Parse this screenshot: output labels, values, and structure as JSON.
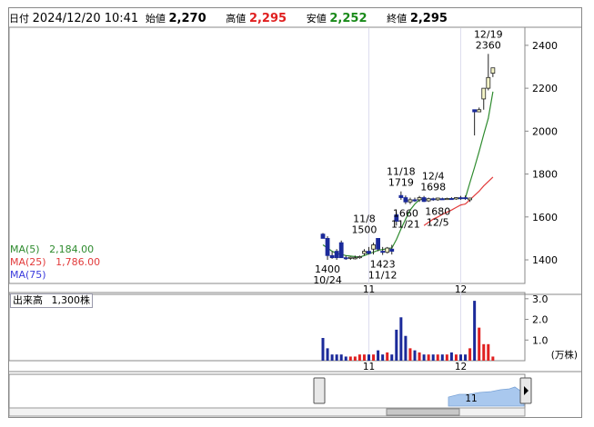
{
  "header": {
    "date_label": "日付",
    "date_value": "2024/12/20 10:41",
    "open_label": "始値",
    "open_value": "2,270",
    "high_label": "高値",
    "high_value": "2,295",
    "low_label": "安値",
    "low_value": "2,252",
    "close_label": "終値",
    "close_value": "2,295"
  },
  "moving_averages": [
    {
      "name": "MA(5)",
      "value": "2,184.00",
      "color": "#2e8b2e"
    },
    {
      "name": "MA(25)",
      "value": "1,786.00",
      "color": "#e23b3b"
    },
    {
      "name": "MA(75)",
      "value": "",
      "color": "#3b3bdd"
    }
  ],
  "volume_legend": {
    "label": "出来高",
    "value": "1,300株"
  },
  "volume_unit": "(万株)",
  "colors": {
    "up": "#f5f5c8",
    "down": "#1b2a9a",
    "vol_up": "#e02020",
    "vol_down": "#1b2a9a",
    "ma5": "#2e8b2e",
    "ma25": "#e23b3b",
    "navigator_fill": "#a9c8ee"
  },
  "chart_data": {
    "type": "candlestick",
    "price_axis": {
      "ticks": [
        1400,
        1600,
        1800,
        2000,
        2200,
        2400
      ],
      "ylim": [
        1290,
        2480
      ]
    },
    "volume_axis": {
      "ticks": [
        "1.0",
        "2.0",
        "3.0"
      ],
      "ylim": [
        0,
        3.3
      ],
      "unit": "(万株)"
    },
    "x_ticks": [
      {
        "label": "11",
        "index": 10
      },
      {
        "label": "12",
        "index": 30
      }
    ],
    "candles": [
      {
        "o": 1520,
        "h": 1525,
        "l": 1500,
        "c": 1500,
        "v": 1.1
      },
      {
        "o": 1500,
        "h": 1510,
        "l": 1400,
        "c": 1420,
        "v": 0.6
      },
      {
        "o": 1420,
        "h": 1440,
        "l": 1405,
        "c": 1410,
        "v": 0.3
      },
      {
        "o": 1440,
        "h": 1450,
        "l": 1400,
        "c": 1410,
        "v": 0.3
      },
      {
        "o": 1480,
        "h": 1490,
        "l": 1420,
        "c": 1410,
        "v": 0.3
      },
      {
        "o": 1410,
        "h": 1420,
        "l": 1400,
        "c": 1405,
        "v": 0.2
      },
      {
        "o": 1410,
        "h": 1415,
        "l": 1400,
        "c": 1412,
        "v": 0.2
      },
      {
        "o": 1405,
        "h": 1420,
        "l": 1402,
        "c": 1410,
        "v": 0.2
      },
      {
        "o": 1410,
        "h": 1420,
        "l": 1405,
        "c": 1415,
        "v": 0.3
      },
      {
        "o": 1430,
        "h": 1450,
        "l": 1420,
        "c": 1440,
        "v": 0.3
      },
      {
        "o": 1440,
        "h": 1460,
        "l": 1425,
        "c": 1430,
        "v": 0.3
      },
      {
        "o": 1450,
        "h": 1480,
        "l": 1425,
        "c": 1470,
        "v": 0.3
      },
      {
        "o": 1500,
        "h": 1500,
        "l": 1440,
        "c": 1450,
        "v": 0.5
      },
      {
        "o": 1440,
        "h": 1460,
        "l": 1423,
        "c": 1435,
        "v": 0.3
      },
      {
        "o": 1435,
        "h": 1460,
        "l": 1430,
        "c": 1455,
        "v": 0.4
      },
      {
        "o": 1450,
        "h": 1470,
        "l": 1425,
        "c": 1440,
        "v": 0.3
      },
      {
        "o": 1610,
        "h": 1620,
        "l": 1560,
        "c": 1580,
        "v": 1.5
      },
      {
        "o": 1700,
        "h": 1719,
        "l": 1680,
        "c": 1690,
        "v": 2.1
      },
      {
        "o": 1690,
        "h": 1700,
        "l": 1660,
        "c": 1670,
        "v": 1.2
      },
      {
        "o": 1670,
        "h": 1690,
        "l": 1660,
        "c": 1680,
        "v": 0.6
      },
      {
        "o": 1680,
        "h": 1690,
        "l": 1670,
        "c": 1675,
        "v": 0.5
      },
      {
        "o": 1680,
        "h": 1698,
        "l": 1670,
        "c": 1690,
        "v": 0.4
      },
      {
        "o": 1690,
        "h": 1698,
        "l": 1670,
        "c": 1672,
        "v": 0.3
      },
      {
        "o": 1675,
        "h": 1690,
        "l": 1670,
        "c": 1685,
        "v": 0.3
      },
      {
        "o": 1685,
        "h": 1690,
        "l": 1675,
        "c": 1680,
        "v": 0.3
      },
      {
        "o": 1680,
        "h": 1690,
        "l": 1675,
        "c": 1688,
        "v": 0.3
      },
      {
        "o": 1685,
        "h": 1690,
        "l": 1680,
        "c": 1682,
        "v": 0.3
      },
      {
        "o": 1682,
        "h": 1690,
        "l": 1680,
        "c": 1686,
        "v": 0.3
      },
      {
        "o": 1686,
        "h": 1692,
        "l": 1680,
        "c": 1684,
        "v": 0.4
      },
      {
        "o": 1684,
        "h": 1692,
        "l": 1680,
        "c": 1690,
        "v": 0.3
      },
      {
        "o": 1690,
        "h": 1698,
        "l": 1680,
        "c": 1685,
        "v": 0.3
      },
      {
        "o": 1690,
        "h": 1700,
        "l": 1680,
        "c": 1685,
        "v": 0.3
      },
      {
        "o": 1680,
        "h": 1690,
        "l": 1670,
        "c": 1688,
        "v": 0.6
      },
      {
        "o": 2100,
        "h": 2100,
        "l": 1980,
        "c": 2090,
        "v": 2.9
      },
      {
        "o": 2090,
        "h": 2110,
        "l": 2090,
        "c": 2100,
        "v": 1.6
      },
      {
        "o": 2150,
        "h": 2200,
        "l": 2100,
        "c": 2200,
        "v": 0.8
      },
      {
        "o": 2200,
        "h": 2360,
        "l": 2190,
        "c": 2250,
        "v": 0.8
      },
      {
        "o": 2270,
        "h": 2295,
        "l": 2252,
        "c": 2295,
        "v": 0.2
      }
    ],
    "ma5_series": [
      1470,
      1455,
      1440,
      1430,
      1425,
      1420,
      1418,
      1415,
      1413,
      1420,
      1428,
      1436,
      1445,
      1448,
      1452,
      1455,
      1495,
      1545,
      1590,
      1632,
      1660,
      1680,
      1683,
      1682,
      1682,
      1683,
      1684,
      1684,
      1685,
      1686,
      1686,
      1687,
      1760,
      1830,
      1905,
      1985,
      2060,
      2184
    ],
    "ma25_series": [
      null,
      null,
      null,
      null,
      null,
      null,
      null,
      null,
      null,
      null,
      null,
      null,
      null,
      null,
      null,
      null,
      null,
      null,
      null,
      null,
      null,
      null,
      1560,
      1575,
      1590,
      1600,
      1612,
      1622,
      1632,
      1644,
      1656,
      1660,
      1680,
      1700,
      1720,
      1745,
      1765,
      1786
    ],
    "annotations": [
      {
        "index": 1,
        "value": 1400,
        "lines": [
          "1400",
          "10/24"
        ],
        "pos": "below"
      },
      {
        "index": 9,
        "value": 1500,
        "lines": [
          "11/8",
          "1500"
        ],
        "pos": "above"
      },
      {
        "index": 13,
        "value": 1423,
        "lines": [
          "1423",
          "11/12"
        ],
        "pos": "below"
      },
      {
        "index": 17,
        "value": 1719,
        "lines": [
          "11/18",
          "1719"
        ],
        "pos": "above"
      },
      {
        "index": 18,
        "value": 1660,
        "lines": [
          "1660",
          "11/21"
        ],
        "pos": "below"
      },
      {
        "index": 24,
        "value": 1698,
        "lines": [
          "12/4",
          "1698"
        ],
        "pos": "above"
      },
      {
        "index": 25,
        "value": 1670,
        "lines": [
          "1680",
          "12/5"
        ],
        "pos": "below"
      },
      {
        "index": 36,
        "value": 2360,
        "lines": [
          "12/19",
          "2360"
        ],
        "pos": "above"
      }
    ]
  },
  "navigator": {
    "tick_label": "11"
  }
}
